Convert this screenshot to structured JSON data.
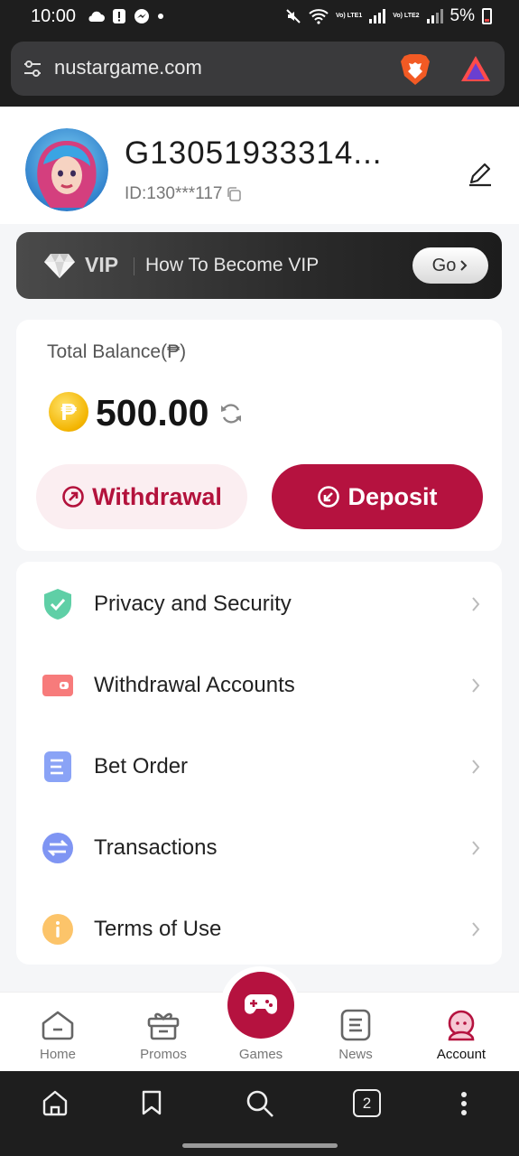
{
  "status_bar": {
    "time": "10:00",
    "lte1": "Vo) LTE1",
    "lte2": "Vo) LTE2",
    "battery": "5%"
  },
  "browser": {
    "url": "nustargame.com",
    "tab_count": "2"
  },
  "profile": {
    "username": "G13051933314...",
    "id_text": "ID:130***117"
  },
  "vip": {
    "label": "VIP",
    "text": "How To Become VIP",
    "go": "Go"
  },
  "balance": {
    "label": "Total Balance(₱)",
    "coin_symbol": "₱",
    "amount": "500.00",
    "withdraw": "Withdrawal",
    "deposit": "Deposit"
  },
  "menu": [
    {
      "label": "Privacy and Security",
      "icon": "shield-check-icon",
      "color": "#5fcfa6"
    },
    {
      "label": "Withdrawal Accounts",
      "icon": "wallet-icon",
      "color": "#f77b7b"
    },
    {
      "label": "Bet Order",
      "icon": "document-icon",
      "color": "#8aa3f6"
    },
    {
      "label": "Transactions",
      "icon": "transfer-icon",
      "color": "#7f95f3"
    },
    {
      "label": "Terms of Use",
      "icon": "info-icon",
      "color": "#fcc46a"
    }
  ],
  "nav": {
    "home": "Home",
    "promos": "Promos",
    "games": "Games",
    "news": "News",
    "account": "Account"
  },
  "colors": {
    "accent": "#b5123f",
    "accent_light": "#fbeef1"
  }
}
